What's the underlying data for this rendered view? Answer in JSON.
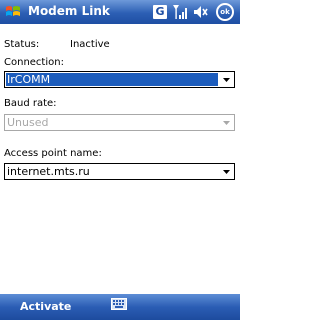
{
  "title_bar": {
    "title": "Modem Link",
    "start_icon": "windows-flag-icon",
    "tray_icons": [
      "g-connection-icon",
      "signal-strength-icon",
      "volume-icon",
      "ok-button"
    ],
    "tray_g_label": "G",
    "ok_label": "ok"
  },
  "status": {
    "label": "Status:",
    "value": "Inactive"
  },
  "connection": {
    "label": "Connection:",
    "value": "IrCOMM"
  },
  "baud_rate": {
    "label": "Baud rate:",
    "value": "Unused"
  },
  "access_point": {
    "label": "Access point name:",
    "value": "internet.mts.ru"
  },
  "menu_bar": {
    "left_softkey": "Activate",
    "sip_icon": "keyboard-icon"
  },
  "colors": {
    "accent": "#2c5fb4",
    "selection": "#1c5cbc",
    "disabled": "#a8a8a8"
  }
}
